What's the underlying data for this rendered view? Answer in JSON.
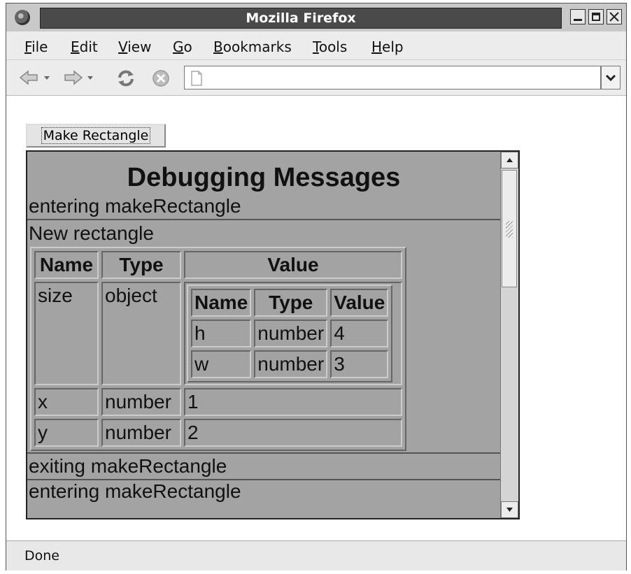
{
  "window": {
    "title": "Mozilla Firefox"
  },
  "menu": [
    {
      "label": "File"
    },
    {
      "label": "Edit"
    },
    {
      "label": "View"
    },
    {
      "label": "Go"
    },
    {
      "label": "Bookmarks"
    },
    {
      "label": "Tools"
    },
    {
      "label": "Help"
    }
  ],
  "toolbar": {
    "url_value": ""
  },
  "page": {
    "make_button_label": "Make Rectangle",
    "debug": {
      "heading": "Debugging Messages",
      "entering": "entering makeRectangle",
      "block_label": "New rectangle",
      "table_headers": [
        "Name",
        "Type",
        "Value"
      ],
      "rows": [
        {
          "name": "size",
          "type": "object"
        },
        {
          "name": "x",
          "type": "number",
          "value": "1"
        },
        {
          "name": "y",
          "type": "number",
          "value": "2"
        }
      ],
      "inner_headers": [
        "Name",
        "Type",
        "Value"
      ],
      "inner_rows": [
        {
          "name": "h",
          "type": "number",
          "value": "4"
        },
        {
          "name": "w",
          "type": "number",
          "value": "3"
        }
      ],
      "exiting": "exiting makeRectangle",
      "partial": "entering makeRectangle"
    }
  },
  "status": {
    "text": "Done"
  }
}
